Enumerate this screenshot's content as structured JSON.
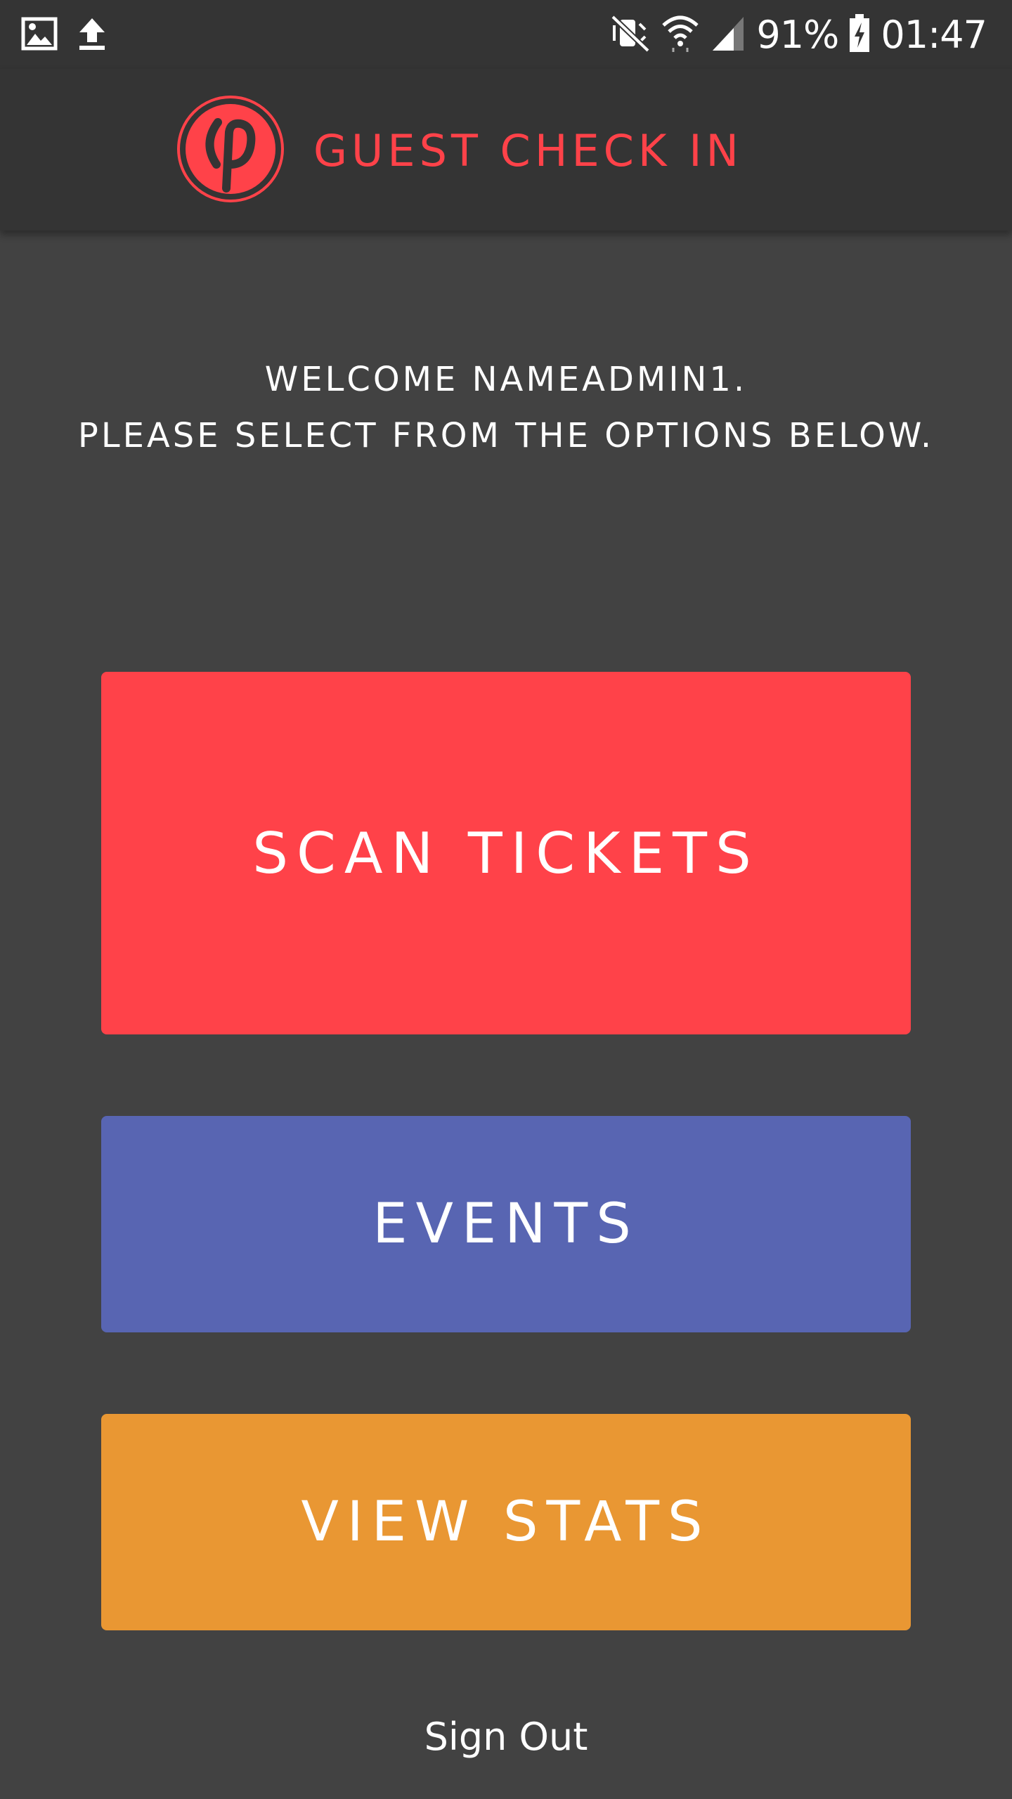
{
  "status_bar": {
    "battery_text": "91%",
    "time": "01:47",
    "icons": [
      "image-icon",
      "upload-icon",
      "mute-icon",
      "wifi-icon",
      "signal-icon",
      "battery-charging-icon"
    ]
  },
  "header": {
    "title": "GUEST CHECK IN",
    "logo_icon": "guest-check-in-logo-icon",
    "accent_color": "#ff4249"
  },
  "welcome": {
    "line1": "WELCOME NAMEADMIN1.",
    "line2": "PLEASE SELECT FROM THE OPTIONS BELOW."
  },
  "menu": {
    "scan_label": "SCAN TICKETS",
    "scan_color": "#ff4249",
    "events_label": "EVENTS",
    "events_color": "#5865b2",
    "stats_label": "VIEW STATS",
    "stats_color": "#e99733"
  },
  "footer": {
    "sign_out_label": "Sign Out"
  }
}
